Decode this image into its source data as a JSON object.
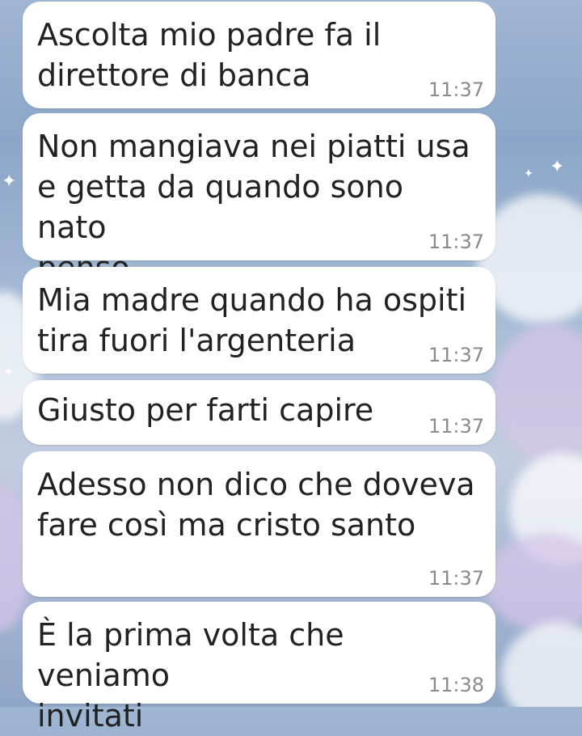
{
  "messages": [
    {
      "text": "Ascolta mio padre fa il\ndirettore di banca",
      "time": "11:37"
    },
    {
      "text": "Non mangiava nei piatti usa\ne getta da quando sono nato\npenso",
      "time": "11:37"
    },
    {
      "text": "Mia madre quando ha ospiti\ntira fuori l'argenteria",
      "time": "11:37"
    },
    {
      "text": "Giusto per farti capire",
      "time": "11:37"
    },
    {
      "text": "Adesso non dico che doveva\nfare così ma cristo santo",
      "time": "11:37"
    },
    {
      "text": "È la prima volta che veniamo\ninvitati",
      "time": "11:38"
    }
  ],
  "colors": {
    "bubble": "#ffffff",
    "message_text": "#222222",
    "timestamp": "#8a8a8a",
    "background_sky": "#8ba6c8"
  },
  "icons": [
    "sparkle-star-icon"
  ]
}
